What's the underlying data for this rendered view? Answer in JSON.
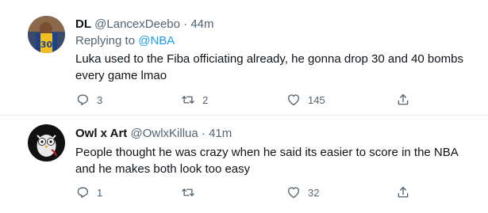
{
  "tweets": [
    {
      "name": "DL",
      "handle": "@LancexDeebo",
      "separator": "·",
      "time": "44m",
      "replying_prefix": "Replying to",
      "replying_to": "@NBA",
      "text": "Luka used to the Fiba officiating already, he gonna drop 30 and 40 bombs every game lmao",
      "reply_count": "3",
      "retweet_count": "2",
      "like_count": "145",
      "avatar": "basketball-player-avatar"
    },
    {
      "name": "Owl x Art",
      "handle": "@OwlxKillua",
      "separator": "·",
      "time": "41m",
      "text": "People thought he was crazy when he said its easier to score in the NBA and he makes both look too easy",
      "reply_count": "1",
      "retweet_count": "",
      "like_count": "32",
      "avatar": "owl-illustration-avatar"
    }
  ],
  "icons": {
    "reply": "reply-icon",
    "retweet": "retweet-icon",
    "like": "heart-icon",
    "share": "share-icon"
  },
  "colors": {
    "text": "#0f1419",
    "secondary": "#536471",
    "link": "#1d9bf0",
    "divider": "#e6ecf0"
  }
}
